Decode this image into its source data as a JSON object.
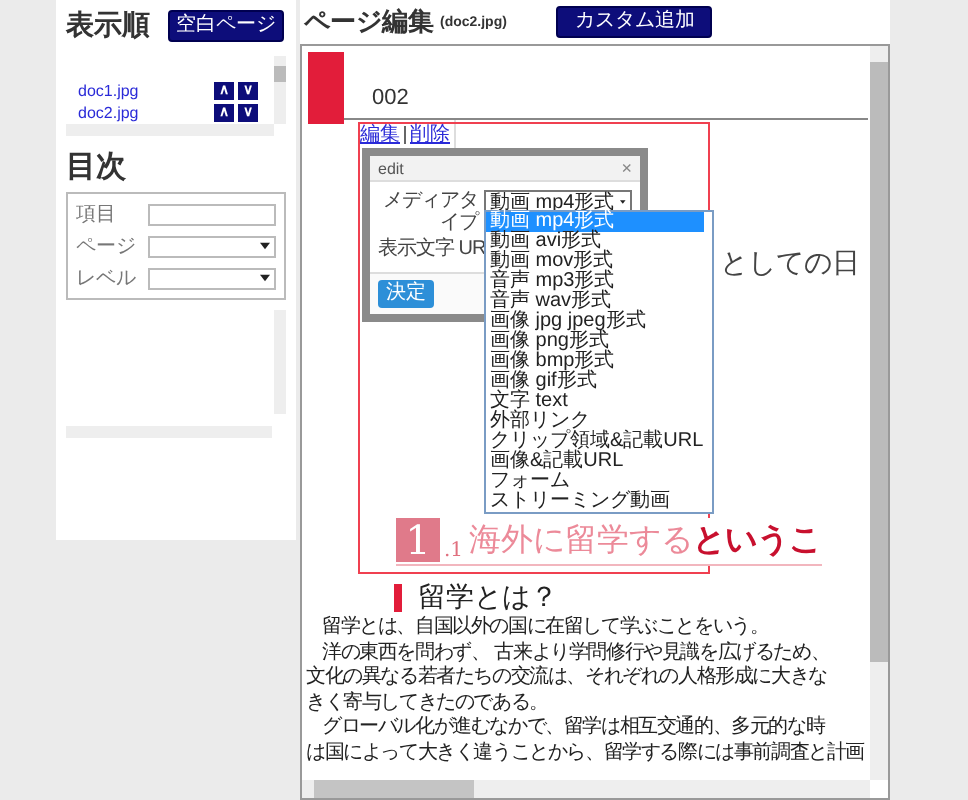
{
  "sidebar": {
    "order_title": "表示順",
    "blank_page_button": "空白ページ",
    "files": [
      {
        "name": "doc1.jpg",
        "up": "∧",
        "down": "∨"
      },
      {
        "name": "doc2.jpg",
        "up": "∧",
        "down": "∨"
      }
    ],
    "toc_title": "目次",
    "toc_fields": [
      {
        "label": "項目",
        "kind": "text"
      },
      {
        "label": "ページ",
        "kind": "select"
      },
      {
        "label": "レベル",
        "kind": "select"
      }
    ]
  },
  "editor": {
    "title": "ページ編集",
    "file": "(doc2.jpg)",
    "custom_button": "カスタム追加"
  },
  "document": {
    "page_number": "002",
    "big_text": "としての日",
    "section_number": "1",
    "section_sub": ".1",
    "section_title_faded": "海外に留学する",
    "section_title": "というこ",
    "heading": "留学とは？",
    "lines": [
      {
        "text": "留学とは、自国以外の国に在留して学ぶことをいう。",
        "indent": true
      },
      {
        "text": "洋の東西を問わず、 古来より学問修行や見識を広げるため、",
        "indent": true
      },
      {
        "text": "文化の異なる若者たちの交流は、それぞれの人格形成に大きな",
        "indent": false
      },
      {
        "text": "きく寄与してきたのである。",
        "indent": false
      },
      {
        "text": "グローバル化が進むなかで、留学は相互交通的、多元的な時",
        "indent": true
      },
      {
        "text": "は国によって大きく違うことから、留学する際には事前調査と計画",
        "indent": false
      }
    ]
  },
  "block_links": [
    "編集",
    "削除"
  ],
  "dialog": {
    "title": "edit",
    "close": "×",
    "media_label": "メディアタイプ",
    "media_value": "動画 mp4形式",
    "text_label": "表示文字 UR",
    "ok": "決定",
    "options": [
      {
        "label": "動画 mp4形式",
        "selected": true
      },
      {
        "label": "動画 avi形式",
        "selected": false
      },
      {
        "label": "動画 mov形式",
        "selected": false
      },
      {
        "label": "音声 mp3形式",
        "selected": false
      },
      {
        "label": "音声 wav形式",
        "selected": false
      },
      {
        "label": "画像 jpg jpeg形式",
        "selected": false
      },
      {
        "label": "画像 png形式",
        "selected": false
      },
      {
        "label": "画像 bmp形式",
        "selected": false
      },
      {
        "label": "画像 gif形式",
        "selected": false
      },
      {
        "label": "文字 text",
        "selected": false
      },
      {
        "label": "外部リンク",
        "selected": false
      },
      {
        "label": "クリップ領域&記載URL",
        "selected": false
      },
      {
        "label": "画像&記載URL",
        "selected": false
      },
      {
        "label": "フォーム",
        "selected": false
      },
      {
        "label": "ストリーミング動画",
        "selected": false
      }
    ]
  }
}
